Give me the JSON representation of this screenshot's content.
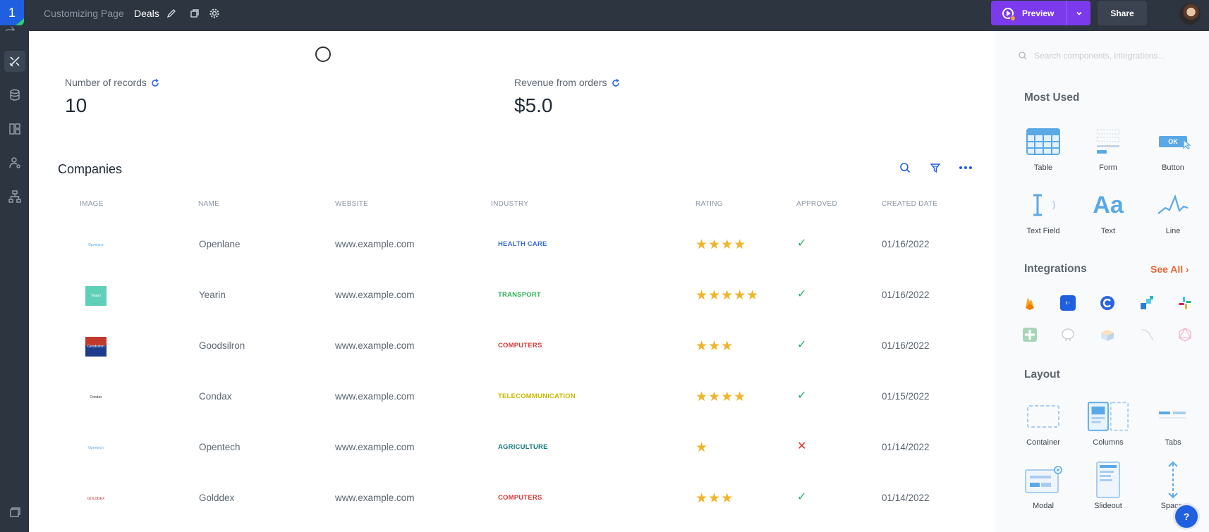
{
  "topbar": {
    "logo": "1",
    "breadcrumb_page": "Customizing Page",
    "breadcrumb_current": "Deals",
    "preview_label": "Preview",
    "share_label": "Share"
  },
  "metrics": [
    {
      "label": "Number of records",
      "value": "10"
    },
    {
      "label": "Revenue from orders",
      "value": "$5.0"
    }
  ],
  "table": {
    "title": "Companies",
    "headers": [
      "IMAGE",
      "NAME",
      "WEBSITE",
      "INDUSTRY",
      "RATING",
      "APPROVED",
      "CREATED DATE"
    ],
    "rows": [
      {
        "logo_text": "Openlane",
        "name": "Openlane",
        "website": "www.example.com",
        "industry": "HEALTH CARE",
        "industry_color": "#3b6fd4",
        "rating": 4,
        "stars": "★★★★",
        "approved": true,
        "approved_mark": "✓",
        "date": "01/16/2022"
      },
      {
        "logo_text": "Yearin",
        "name": "Yearin",
        "website": "www.example.com",
        "industry": "TRANSPORT",
        "industry_color": "#2fb35a",
        "rating": 5,
        "stars": "★★★★★",
        "approved": true,
        "approved_mark": "✓",
        "date": "01/16/2022"
      },
      {
        "logo_text": "Goodsilron",
        "name": "Goodsilron",
        "website": "www.example.com",
        "industry": "COMPUTERS",
        "industry_color": "#d63a3a",
        "rating": 3,
        "stars": "★★★",
        "approved": true,
        "approved_mark": "✓",
        "date": "01/16/2022"
      },
      {
        "logo_text": "Condax",
        "name": "Condax",
        "website": "www.example.com",
        "industry": "TELECOMMUNICATION",
        "industry_color": "#c9b800",
        "rating": 4,
        "stars": "★★★★",
        "approved": true,
        "approved_mark": "✓",
        "date": "01/15/2022"
      },
      {
        "logo_text": "Opentech",
        "name": "Opentech",
        "website": "www.example.com",
        "industry": "AGRICULTURE",
        "industry_color": "#157a7a",
        "rating": 1,
        "stars": "★",
        "approved": false,
        "approved_mark": "✕",
        "date": "01/14/2022"
      },
      {
        "logo_text": "GOLDDEX",
        "name": "Golddex",
        "website": "www.example.com",
        "industry": "COMPUTERS",
        "industry_color": "#d63a3a",
        "rating": 3,
        "stars": "★★★",
        "approved": true,
        "approved_mark": "✓",
        "date": "01/14/2022"
      }
    ]
  },
  "panel": {
    "search_placeholder": "Search components, integrations...",
    "most_used_title": "Most Used",
    "most_used": [
      {
        "label": "Table",
        "icon": "table-icon"
      },
      {
        "label": "Form",
        "icon": "form-icon"
      },
      {
        "label": "Button",
        "icon": "button-icon",
        "icon_text": "OK"
      },
      {
        "label": "Text Field",
        "icon": "text-field-icon"
      },
      {
        "label": "Text",
        "icon": "text-icon",
        "icon_text": "Aa"
      },
      {
        "label": "Line",
        "icon": "line-chart-icon"
      }
    ],
    "integrations_title": "Integrations",
    "see_all": "See All",
    "integrations": [
      "firebase-icon",
      "airtable-icon",
      "supabase-icon",
      "stripe-icon",
      "slack-icon",
      "google-sheets-icon",
      "postgres-icon",
      "box-icon",
      "mysql-icon",
      "graphql-icon"
    ],
    "layout_title": "Layout",
    "layout": [
      {
        "label": "Container",
        "icon": "container-icon"
      },
      {
        "label": "Columns",
        "icon": "columns-icon"
      },
      {
        "label": "Tabs",
        "icon": "tabs-icon"
      },
      {
        "label": "Modal",
        "icon": "modal-icon"
      },
      {
        "label": "Slideout",
        "icon": "slideout-icon"
      },
      {
        "label": "Spacer",
        "icon": "spacer-icon"
      }
    ]
  },
  "help_label": "?",
  "colors": {
    "accent": "#7c3aed",
    "brand": "#1f5fe0",
    "topbar": "#2d3540",
    "link": "#e8673a",
    "star": "#f0b429",
    "icon_blue": "#5aa9e6"
  }
}
